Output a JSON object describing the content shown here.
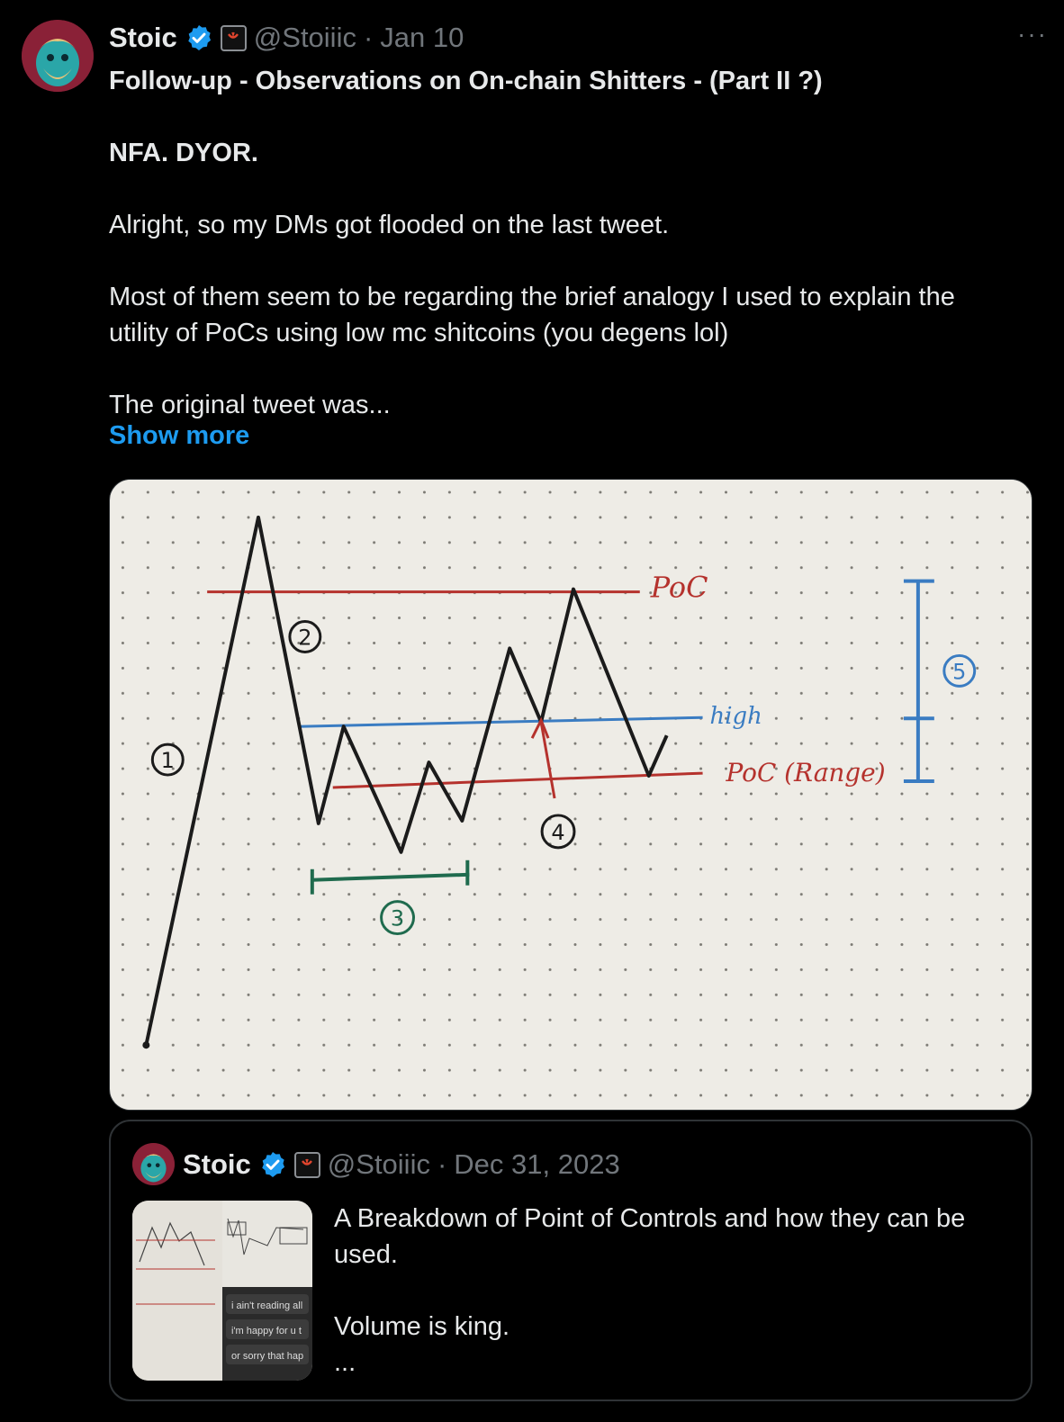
{
  "tweet": {
    "author_name": "Stoic",
    "handle": "@Stoiiic",
    "separator": "·",
    "date": "Jan 10",
    "more_label": "···",
    "title": "Follow-up - Observations on On-chain Shitters - (Part II ?)",
    "line_nfa": "NFA. DYOR.",
    "line_dms": "Alright, so my DMs got flooded on the last tweet.",
    "line_most": "Most of them seem to be regarding the brief analogy I used to explain the utility of PoCs using low mc shitcoins (you degens lol)",
    "line_original": "The original tweet was...",
    "show_more": "Show more",
    "media": {
      "annotations": {
        "poc_top": "PoC",
        "high": "high",
        "poc_range": "PoC (Range)",
        "n1": "1",
        "n2": "2",
        "n3": "3",
        "n4": "4",
        "n5": "5"
      }
    }
  },
  "quote": {
    "author_name": "Stoic",
    "handle": "@Stoiiic",
    "separator": "·",
    "date": "Dec 31, 2023",
    "text_line1": "A Breakdown of Point of Controls and how they can be used.",
    "text_line2": "Volume is king.",
    "text_ellipsis": "...",
    "thumb_chat": [
      "i ain't reading all",
      "i'm happy for u t",
      "or sorry that hap"
    ]
  },
  "colors": {
    "background": "#000000",
    "text": "#e7e9ea",
    "muted": "#71767b",
    "link": "#1d9bf0",
    "border": "#2f3336",
    "verified": "#1d9bf0",
    "ink_red": "#b5322d",
    "ink_blue": "#3a7cc2",
    "ink_green": "#1f6b4e"
  }
}
